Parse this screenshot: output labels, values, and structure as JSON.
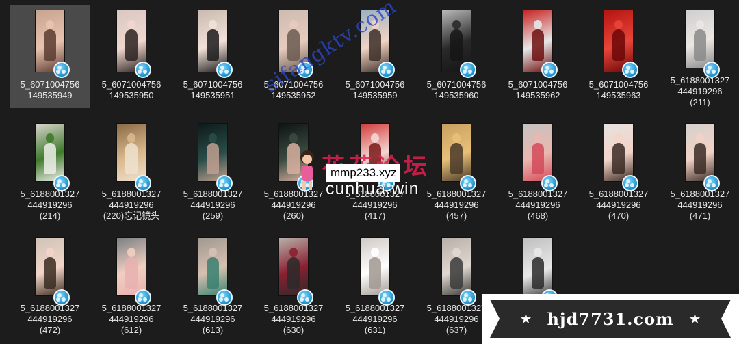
{
  "files": [
    {
      "line1": "5_6071004756",
      "line2": "149535949",
      "line3": "",
      "selected": true,
      "palette": [
        "#c7a48f",
        "#e9c3b0",
        "#5a3b30"
      ]
    },
    {
      "line1": "5_6071004756",
      "line2": "149535950",
      "line3": "",
      "palette": [
        "#d9c8c2",
        "#f0d7cf",
        "#2a2220"
      ]
    },
    {
      "line1": "5_6071004756",
      "line2": "149535951",
      "line3": "",
      "palette": [
        "#c9bab0",
        "#f2e1d8",
        "#1b1b1b"
      ]
    },
    {
      "line1": "5_6071004756",
      "line2": "149535952",
      "line3": "",
      "palette": [
        "#cdbcb1",
        "#e7cbbd",
        "#6a5a50"
      ]
    },
    {
      "line1": "5_6071004756",
      "line2": "149535959",
      "line3": "",
      "palette": [
        "#9ab0c0",
        "#f0d4c4",
        "#3c2e28"
      ]
    },
    {
      "line1": "5_6071004756",
      "line2": "149535960",
      "line3": "",
      "palette": [
        "#b8b8b8",
        "#2a2a2a",
        "#151515"
      ]
    },
    {
      "line1": "5_6071004756",
      "line2": "149535962",
      "line3": "",
      "palette": [
        "#c92323",
        "#e7e7e7",
        "#6d1010"
      ]
    },
    {
      "line1": "5_6071004756",
      "line2": "149535963",
      "line3": "",
      "palette": [
        "#b3150f",
        "#e8453a",
        "#6b0707"
      ]
    },
    {
      "line1": "5_6188001327",
      "line2": "444919296",
      "line3": "(211)",
      "palette": [
        "#cfcfcf",
        "#ebe6e2",
        "#8a8a8a"
      ]
    },
    {
      "line1": "5_6188001327",
      "line2": "444919296",
      "line3": "(214)",
      "palette": [
        "#d8d4cc",
        "#3f7a2c",
        "#efefea"
      ]
    },
    {
      "line1": "5_6188001327",
      "line2": "444919296",
      "line3": "(220)忘记镜头",
      "palette": [
        "#8a6a46",
        "#d9b88d",
        "#efe2cf"
      ]
    },
    {
      "line1": "5_6188001327",
      "line2": "444919296",
      "line3": "(259)",
      "palette": [
        "#0d1a1a",
        "#2a4c48",
        "#c0a090"
      ]
    },
    {
      "line1": "5_6188001327",
      "line2": "444919296",
      "line3": "(260)",
      "palette": [
        "#0e1416",
        "#3a4a40",
        "#d8b0a0"
      ]
    },
    {
      "line1": "5_6188001327",
      "line2": "444919296",
      "line3": "(417)",
      "palette": [
        "#d23c3c",
        "#f3d7d2",
        "#7a1a1a"
      ]
    },
    {
      "line1": "5_6188001327",
      "line2": "444919296",
      "line3": "(457)",
      "palette": [
        "#c9a060",
        "#e8c078",
        "#4a3a28"
      ]
    },
    {
      "line1": "5_6188001327",
      "line2": "444919296",
      "line3": "(468)",
      "palette": [
        "#c7c2bf",
        "#e9b8b0",
        "#d44a5a"
      ]
    },
    {
      "line1": "5_6188001327",
      "line2": "444919296",
      "line3": "(470)",
      "palette": [
        "#e6e1de",
        "#f3d4c8",
        "#3a2a24"
      ]
    },
    {
      "line1": "5_6188001327",
      "line2": "444919296",
      "line3": "(471)",
      "palette": [
        "#d6d0cc",
        "#f1d2c6",
        "#3a2b26"
      ]
    },
    {
      "line1": "5_6188001327",
      "line2": "444919296",
      "line3": "(472)",
      "palette": [
        "#cfc3b8",
        "#f2d5c8",
        "#3a2a20"
      ]
    },
    {
      "line1": "5_6188001327",
      "line2": "444919296",
      "line3": "(612)",
      "palette": [
        "#7c7f82",
        "#f0cfc0",
        "#e8b0b0"
      ]
    },
    {
      "line1": "5_6188001327",
      "line2": "444919296",
      "line3": "(613)",
      "palette": [
        "#a09890",
        "#d6c0b0",
        "#3a8070"
      ]
    },
    {
      "line1": "5_6188001327",
      "line2": "444919296",
      "line3": "(630)",
      "palette": [
        "#b8b0aa",
        "#8a2030",
        "#2a2a2a"
      ]
    },
    {
      "line1": "5_6188001327",
      "line2": "444919296",
      "line3": "(631)",
      "palette": [
        "#cfc8c4",
        "#ffffff",
        "#a09890"
      ]
    },
    {
      "line1": "5_6188001327",
      "line2": "444919296",
      "line3": "(637)",
      "palette": [
        "#b8b0a8",
        "#e0d8d0",
        "#3a3a3a"
      ]
    },
    {
      "line1": "",
      "line2": "",
      "line3": "",
      "palette": [
        "#bfbfbf",
        "#e8e8e8",
        "#2a2a2a"
      ]
    }
  ],
  "watermarks": {
    "diagonal": "sifangktv.com",
    "forum": "花花论坛",
    "url_box": "mmp233.xyz",
    "url2": "cunhua.win"
  },
  "banner": {
    "text": "hjd7731.com",
    "star": "★"
  },
  "icon_names": {
    "badge": "media-player-icon"
  }
}
